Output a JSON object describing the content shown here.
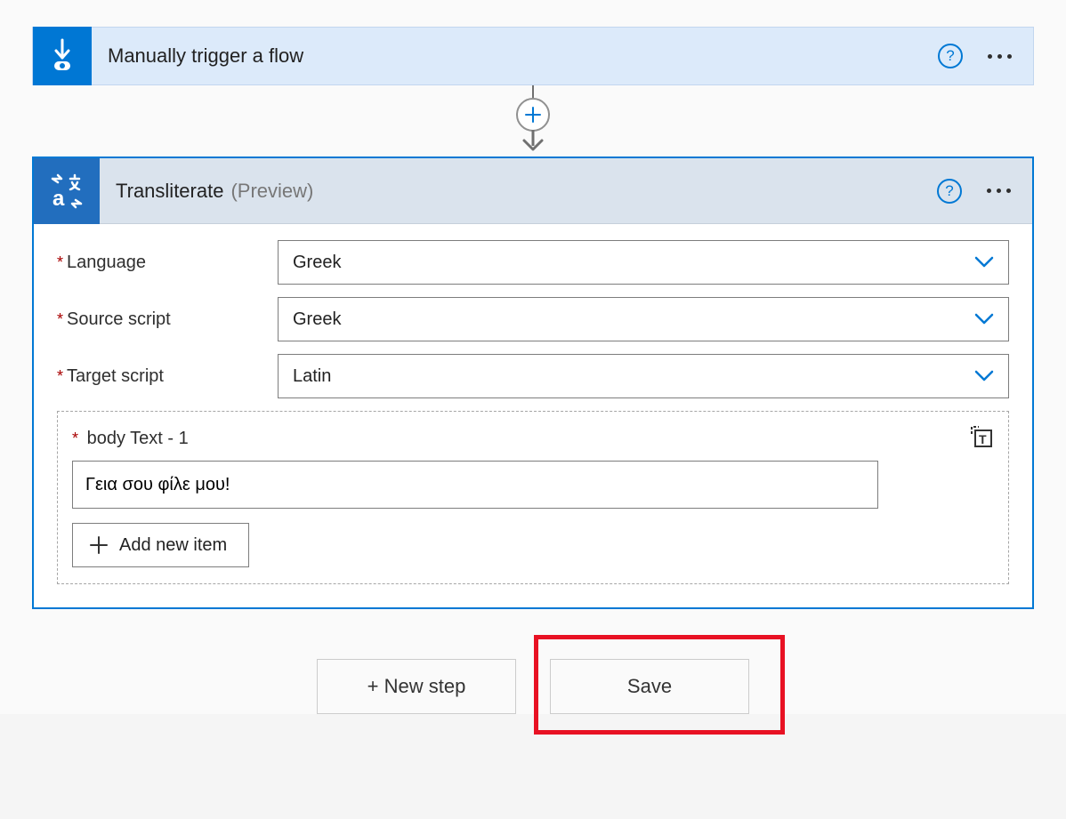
{
  "trigger": {
    "title": "Manually trigger a flow"
  },
  "action": {
    "title": "Transliterate",
    "subtitle": "(Preview)",
    "fields": {
      "language": {
        "label": "Language",
        "value": "Greek"
      },
      "source_script": {
        "label": "Source script",
        "value": "Greek"
      },
      "target_script": {
        "label": "Target script",
        "value": "Latin"
      }
    },
    "body_text": {
      "label": "body Text - 1",
      "value": "Γεια σου φίλε μου!"
    },
    "add_new_item_label": "Add new item"
  },
  "footer": {
    "new_step_label": "+ New step",
    "save_label": "Save"
  },
  "help_icon_char": "?"
}
